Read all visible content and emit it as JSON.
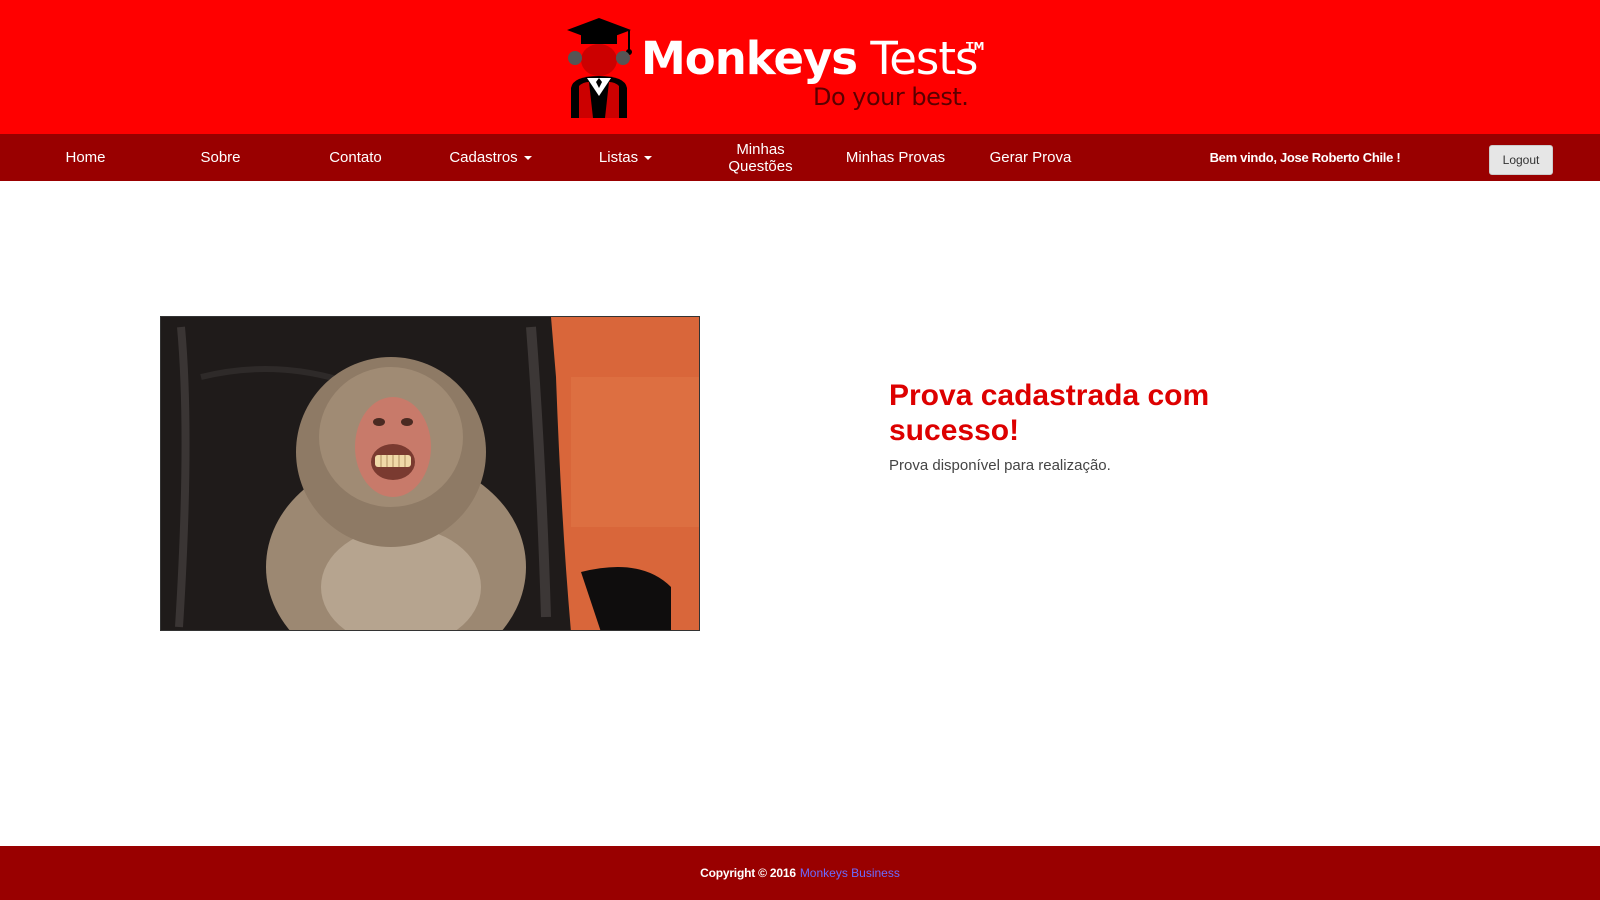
{
  "brand": {
    "title_bold": "Monkeys",
    "title_light": "Tests",
    "trademark": "TM",
    "tagline": "Do your best.",
    "bg_color": "#ff0000"
  },
  "nav": {
    "items": [
      {
        "label": "Home"
      },
      {
        "label": "Sobre"
      },
      {
        "label": "Contato"
      },
      {
        "label": "Cadastros"
      },
      {
        "label": "Listas"
      },
      {
        "label": "Minhas Questões"
      },
      {
        "label": "Minhas Provas"
      },
      {
        "label": "Gerar Prova"
      }
    ],
    "welcome": "Bem vindo, Jose Roberto Chile !",
    "logout_label": "Logout",
    "bg_color": "#990000"
  },
  "main": {
    "image_subject": "baboon-sitting-in-leather-chair",
    "title": "Prova cadastrada com sucesso!",
    "subtitle": "Prova disponível para realização.",
    "title_color": "#dd0000"
  },
  "footer": {
    "copyright": "Copyright © 2016",
    "company": "Monkeys Business"
  }
}
